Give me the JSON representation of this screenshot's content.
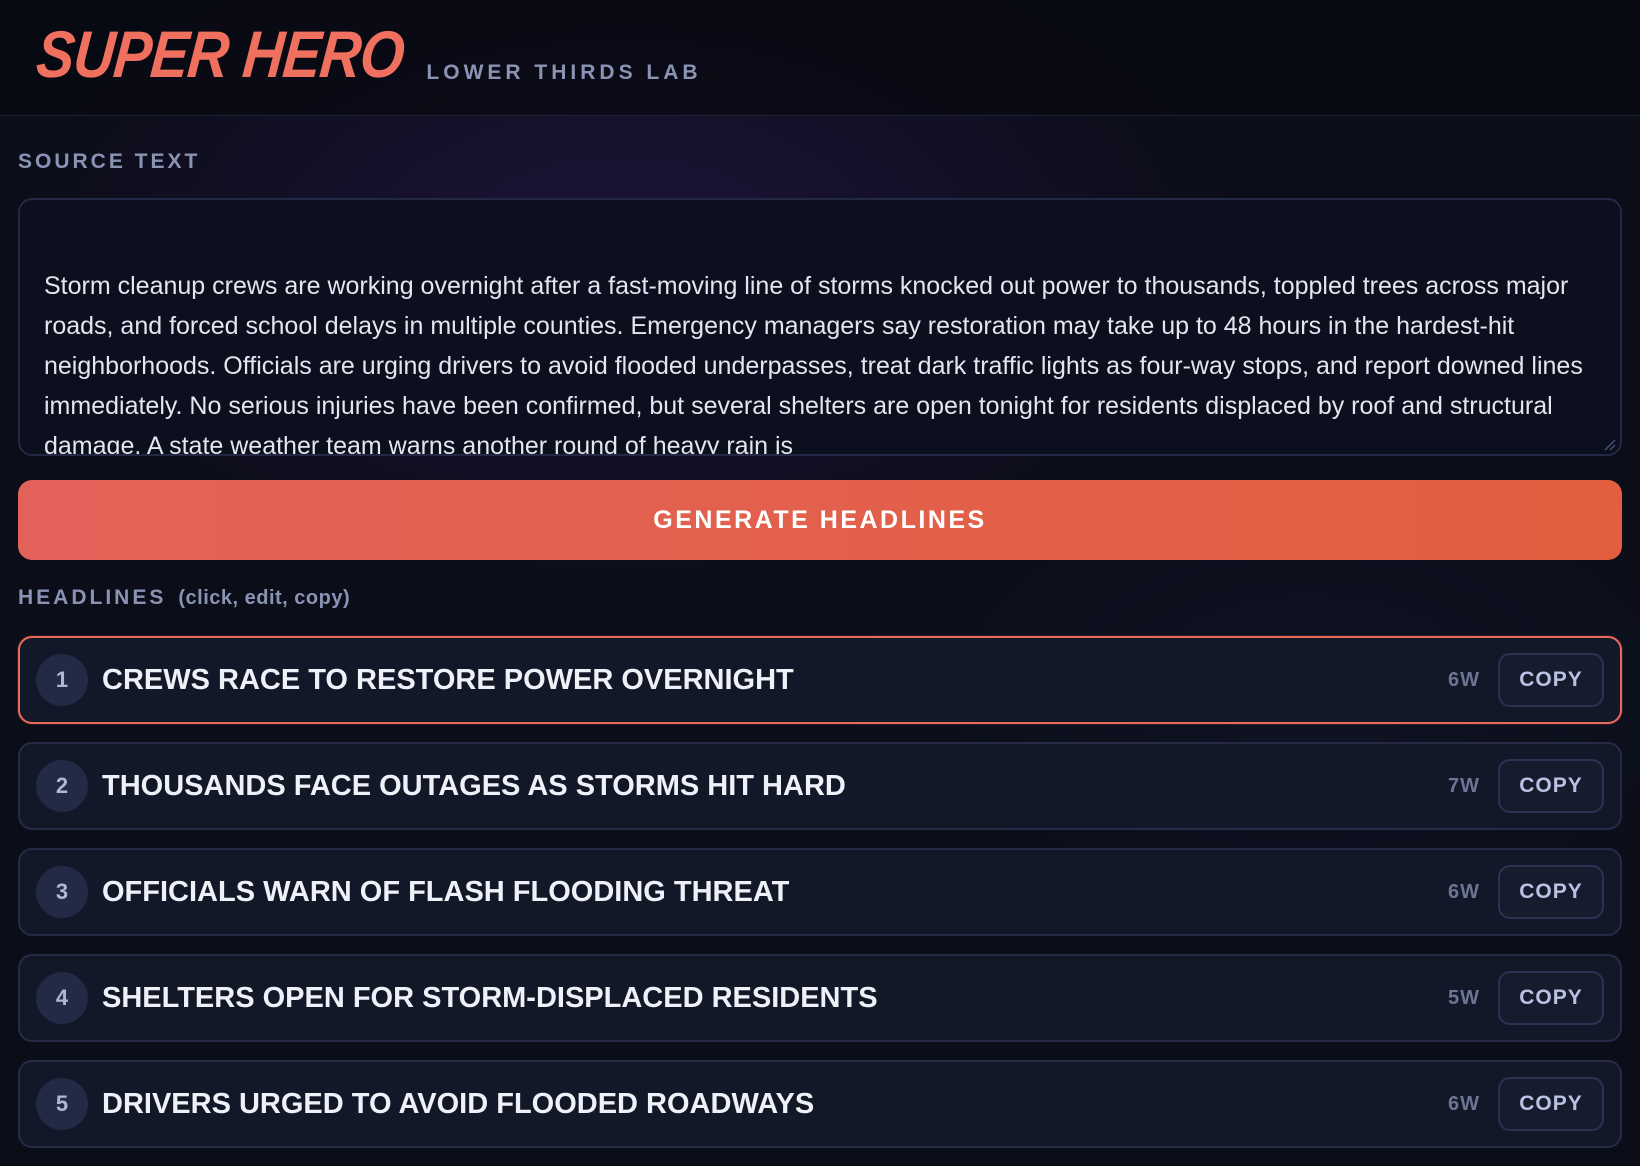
{
  "header": {
    "logo": "SUPER HERO",
    "subtitle": "LOWER THIRDS LAB"
  },
  "source": {
    "label": "SOURCE TEXT",
    "text": "Storm cleanup crews are working overnight after a fast-moving line of storms knocked out power to thousands, toppled trees across major roads, and forced school delays in multiple counties. Emergency managers say restoration may take up to 48 hours in the hardest-hit neighborhoods. Officials are urging drivers to avoid flooded underpasses, treat dark traffic lights as four-way stops, and report downed lines immediately. No serious injuries have been confirmed, but several shelters are open tonight for residents displaced by roof and structural damage. A state weather team warns another round of heavy rain is"
  },
  "generate_button": "GENERATE HEADLINES",
  "headlines": {
    "label": "HEADLINES",
    "hint": "(click, edit, copy)",
    "copy_label": "COPY",
    "items": [
      {
        "num": "1",
        "text": "CREWS RACE TO RESTORE POWER OVERNIGHT",
        "words": "6W",
        "active": true
      },
      {
        "num": "2",
        "text": "THOUSANDS FACE OUTAGES AS STORMS HIT HARD",
        "words": "7W",
        "active": false
      },
      {
        "num": "3",
        "text": "OFFICIALS WARN OF FLASH FLOODING THREAT",
        "words": "6W",
        "active": false
      },
      {
        "num": "4",
        "text": "SHELTERS OPEN FOR STORM-DISPLACED RESIDENTS",
        "words": "5W",
        "active": false
      },
      {
        "num": "5",
        "text": "DRIVERS URGED TO AVOID FLOODED ROADWAYS",
        "words": "6W",
        "active": false
      }
    ]
  },
  "colors": {
    "accent": "#e8685a",
    "background": "#0b0d18",
    "card": "#131829"
  }
}
